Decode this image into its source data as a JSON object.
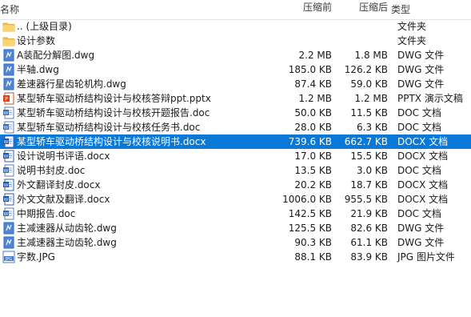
{
  "columns": {
    "name": "名称",
    "size_before": "压缩前",
    "size_after": "压缩后",
    "type": "类型"
  },
  "selected_index": 9,
  "files": [
    {
      "name": ".. (上级目录)",
      "before": "",
      "after": "",
      "type": "文件夹",
      "icon": "folder-icon"
    },
    {
      "name": "设计参数",
      "before": "",
      "after": "",
      "type": "文件夹",
      "icon": "folder-icon"
    },
    {
      "name": "A装配分解图.dwg",
      "before": "2.2 MB",
      "after": "1.8 MB",
      "type": "DWG 文件",
      "icon": "dwg-file-icon"
    },
    {
      "name": "半轴.dwg",
      "before": "185.0 KB",
      "after": "126.2 KB",
      "type": "DWG 文件",
      "icon": "dwg-file-icon"
    },
    {
      "name": "差速器行星齿轮机构.dwg",
      "before": "87.4 KB",
      "after": "59.0 KB",
      "type": "DWG 文件",
      "icon": "dwg-file-icon"
    },
    {
      "name": "某型轿车驱动桥结构设计与校核答辩ppt.pptx",
      "before": "1.2 MB",
      "after": "1.2 MB",
      "type": "PPTX 演示文稿",
      "icon": "pptx-file-icon"
    },
    {
      "name": "某型轿车驱动桥结构设计与校核开题报告.doc",
      "before": "50.0 KB",
      "after": "11.5 KB",
      "type": "DOC 文档",
      "icon": "doc-file-icon"
    },
    {
      "name": "某型轿车驱动桥结构设计与校核任务书.doc",
      "before": "28.0 KB",
      "after": "6.3 KB",
      "type": "DOC 文档",
      "icon": "doc-file-icon"
    },
    {
      "name": "某型轿车驱动桥结构设计与校核说明书.docx",
      "before": "739.6 KB",
      "after": "662.7 KB",
      "type": "DOCX 文档",
      "icon": "docx-file-icon"
    },
    {
      "name": "设计说明书评语.docx",
      "before": "17.0 KB",
      "after": "15.5 KB",
      "type": "DOCX 文档",
      "icon": "docx-file-icon"
    },
    {
      "name": "说明书封皮.doc",
      "before": "13.5 KB",
      "after": "3.0 KB",
      "type": "DOC 文档",
      "icon": "doc-file-icon"
    },
    {
      "name": "外文翻译封皮.docx",
      "before": "20.2 KB",
      "after": "18.7 KB",
      "type": "DOCX 文档",
      "icon": "docx-file-icon"
    },
    {
      "name": "外文文献及翻译.docx",
      "before": "1006.0 KB",
      "after": "955.5 KB",
      "type": "DOCX 文档",
      "icon": "docx-file-icon"
    },
    {
      "name": "中期报告.doc",
      "before": "142.5 KB",
      "after": "21.9 KB",
      "type": "DOC 文档",
      "icon": "doc-file-icon"
    },
    {
      "name": "主减速器从动齿轮.dwg",
      "before": "125.5 KB",
      "after": "82.6 KB",
      "type": "DWG 文件",
      "icon": "dwg-file-icon"
    },
    {
      "name": "主减速器主动齿轮.dwg",
      "before": "90.3 KB",
      "after": "61.1 KB",
      "type": "DWG 文件",
      "icon": "dwg-file-icon"
    },
    {
      "name": "字数.JPG",
      "before": "88.1 KB",
      "after": "83.9 KB",
      "type": "JPG 图片文件",
      "icon": "jpg-file-icon"
    }
  ]
}
